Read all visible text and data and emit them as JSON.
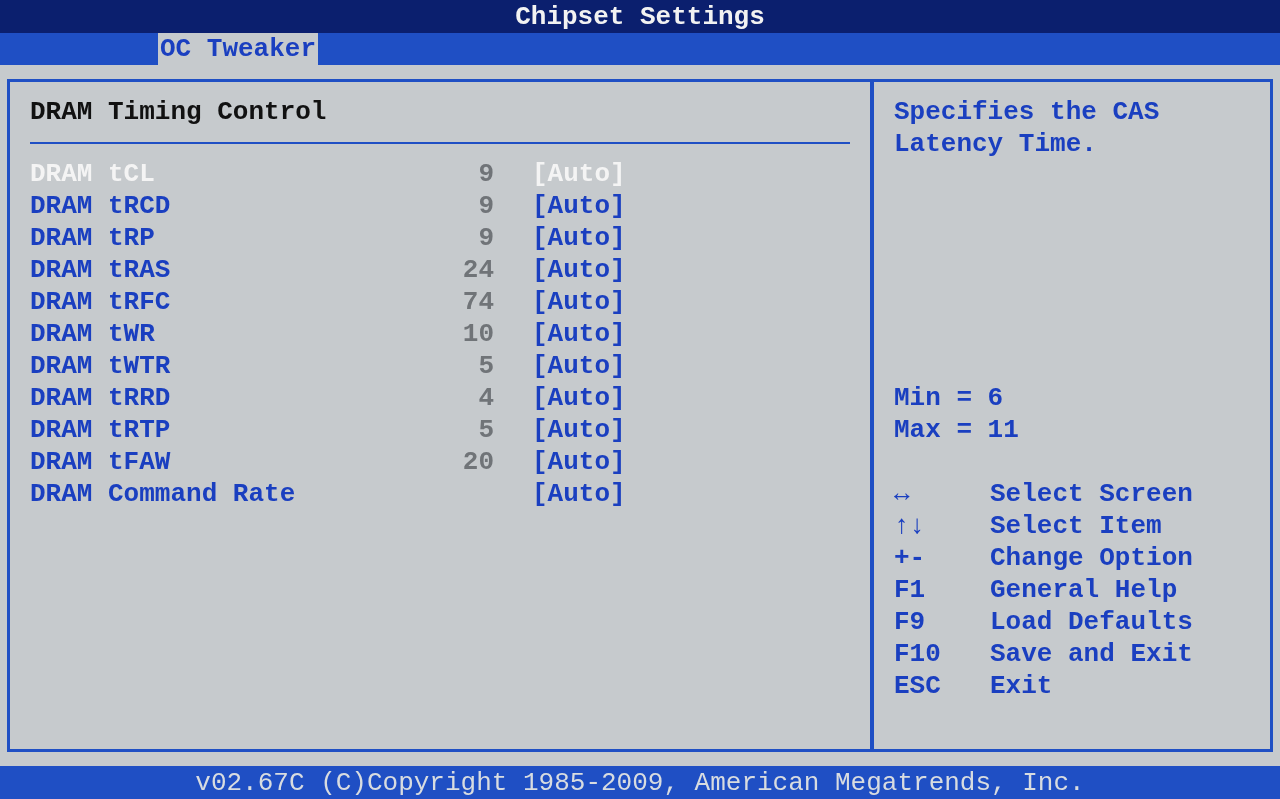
{
  "window": {
    "title": "Chipset Settings"
  },
  "tabs": [
    {
      "label": "OC Tweaker",
      "selected": true
    }
  ],
  "section": {
    "heading": "DRAM Timing Control",
    "rows": [
      {
        "name": "DRAM tCL",
        "value": "9",
        "option": "[Auto]",
        "selected": true
      },
      {
        "name": "DRAM tRCD",
        "value": "9",
        "option": "[Auto]",
        "selected": false
      },
      {
        "name": "DRAM tRP",
        "value": "9",
        "option": "[Auto]",
        "selected": false
      },
      {
        "name": "DRAM tRAS",
        "value": "24",
        "option": "[Auto]",
        "selected": false
      },
      {
        "name": "DRAM tRFC",
        "value": "74",
        "option": "[Auto]",
        "selected": false
      },
      {
        "name": "DRAM tWR",
        "value": "10",
        "option": "[Auto]",
        "selected": false
      },
      {
        "name": "DRAM tWTR",
        "value": "5",
        "option": "[Auto]",
        "selected": false
      },
      {
        "name": "DRAM tRRD",
        "value": "4",
        "option": "[Auto]",
        "selected": false
      },
      {
        "name": "DRAM tRTP",
        "value": "5",
        "option": "[Auto]",
        "selected": false
      },
      {
        "name": "DRAM tFAW",
        "value": "20",
        "option": "[Auto]",
        "selected": false
      },
      {
        "name": "DRAM Command Rate",
        "option": "[Auto]",
        "selected": false
      }
    ]
  },
  "help": {
    "text": "Specifies the CAS Latency Time.",
    "range": [
      "Min = 6",
      "Max = 11"
    ],
    "keys": [
      {
        "key": "↔",
        "action": "Select Screen"
      },
      {
        "key": "↑↓",
        "action": "Select Item"
      },
      {
        "key": "+-",
        "action": "Change Option"
      },
      {
        "key": "F1",
        "action": "General Help"
      },
      {
        "key": "F9",
        "action": "Load Defaults"
      },
      {
        "key": "F10",
        "action": "Save and Exit"
      },
      {
        "key": "ESC",
        "action": "Exit"
      }
    ]
  },
  "status_bar": "v02.67C (C)Copyright 1985-2009, American Megatrends, Inc."
}
